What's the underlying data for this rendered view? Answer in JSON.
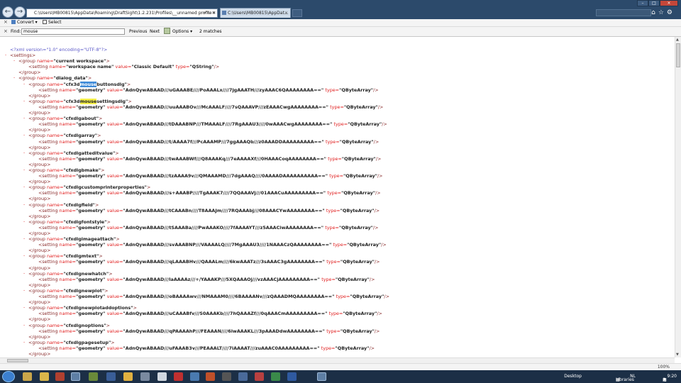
{
  "window": {
    "address": "C:\\Users\\MB00815\\AppData\\Roaming\\DraftSight\\1.2.231\\Profiles\\__unnamed profile",
    "address_icons": "⌕ ▾ ↻ ✖",
    "tab_title": "C:\\Users\\MB00815\\AppDat...",
    "tab_close": "×",
    "win_min": "–",
    "win_max": "□",
    "win_close": "×",
    "right_icons": "⌂☆⚙"
  },
  "toolbar": {
    "close": "×",
    "convert_label": "Convert",
    "convert_arrow": "▾",
    "select_label": "Select"
  },
  "findbar": {
    "close": "×",
    "find_label": "Find:",
    "find_value": "mouse",
    "previous": "Previous",
    "next": "Next",
    "options": "Options",
    "options_arrow": "▾",
    "matches": "2 matches"
  },
  "status": {
    "zoom": "100%"
  },
  "taskbar": {
    "desktop": "Desktop",
    "libraries": "Libraries",
    "lang": "NL",
    "time": "9:20"
  },
  "xml": {
    "pi_text": "<?xml version=\"1.0\" encoding=\"UTF-8\"?>",
    "root": "settings",
    "workspace_group": "current workspace",
    "workspace_setting": "workspace name",
    "workspace_value": "Classic Default",
    "workspace_type": "QString",
    "dialog_group": "dialog_data",
    "setting_name": "geometry",
    "setting_type": "QByteArray",
    "groups": [
      {
        "name": [
          "cfx3d",
          "mouse",
          "buttonsdlg"
        ],
        "value": "AdnQywABAAD///uGAAABE////PoAAALx////7jgAAATH///zyAAAC6QAAAAAAAA=="
      },
      {
        "name": [
          "cfx3d",
          "mouse",
          "settingsdlg"
        ],
        "value": "AdnQywABAAD///uuAAABOv///McAAALF////7sQAAAVP///zEAAACwgAAAAAAAA=="
      },
      {
        "name": [
          "cfxdlgabout"
        ],
        "value": "AdnQywABAAD///tDAAABNP///TMAAALF////7RgAAAU3////0wAAACwgAAAAAAAA=="
      },
      {
        "name": [
          "cfxdlgarray"
        ],
        "value": "AdnQywABAAD///t/AAAA7f///PcAAAMP///7ggAAAQb///z0AAADDAAAAAAAAA=="
      },
      {
        "name": [
          "cfxdlgatteditvalue"
        ],
        "value": "AdnQywABAAD///twAAABWf///Q8AAAKq///7eAAAAXf///0HAAACoqAAAAAAAA=="
      },
      {
        "name": [
          "cfxdlgbmake"
        ],
        "value": "AdnQywABAAD///tzAAAA9v///QMAAAMD///7dgAAAQ////0AAAADAAAAAAAAAA=="
      },
      {
        "name": [
          "cfxdlgcustomprinterproperties"
        ],
        "value": "AdnQywABAAD///s+AAABP////TgAAAK7////7QQAAAVj///01AAACuAAAAAAAAA=="
      },
      {
        "name": [
          "cfxdlgfield"
        ],
        "value": "AdnQywABAAD///tCAAABn////T8AAAJm////7RQAAAbj///08AAACYwAAAAAAAA=="
      },
      {
        "name": [
          "cfxdlgfontstyle"
        ],
        "value": "AdnQywABAAD///tSAAABa////PwAAAKO////7fAAAAYT///z5AAACiwAAAAAAAA=="
      },
      {
        "name": [
          "cfxdlgimageattach"
        ],
        "value": "AdnQywABAAD///svAAABNP///VAAAALQ////7MgAAAU3////1NAAACzQAAAAAAAA=="
      },
      {
        "name": [
          "cfxdlgmtext"
        ],
        "value": "AdnQywABAAD///qLAAABHv///QAAALm////6kwAAATz///3sAAAC3gAAAAAAAA=="
      },
      {
        "name": [
          "cfxdlgnewhatch"
        ],
        "value": "AdnQywABAAD///laAAAAz///+/YAAAKP///5XQAAAOj///vzAAACjAAAAAAAAA=="
      },
      {
        "name": [
          "cfxdlgnewplot"
        ],
        "value": "AdnQywABAAD///oBAAAAwv///NMAAAM0////6BAAAANv///zQAAADMQAAAAAAAA=="
      },
      {
        "name": [
          "cfxdlgnewplotaddoptions"
        ],
        "value": "AdnQywABAAD///uCAAABfv///S0AAAKb////7hQAAAZf///0qAAACmAAAAAAAAA=="
      },
      {
        "name": [
          "cfxdlgnoptions"
        ],
        "value": "AdnQywABAAD///qPAAAAhP///FEAAAN////6lwAAAKL///3pAAADdwAAAAAAAA=="
      },
      {
        "name": [
          "cfxdlgpagesetup"
        ],
        "value": "AdnQywABAAD///uFAAAB3v///PEAAALT////7iAAAAT///zuAAAC0AAAAAAAAA=="
      }
    ]
  }
}
